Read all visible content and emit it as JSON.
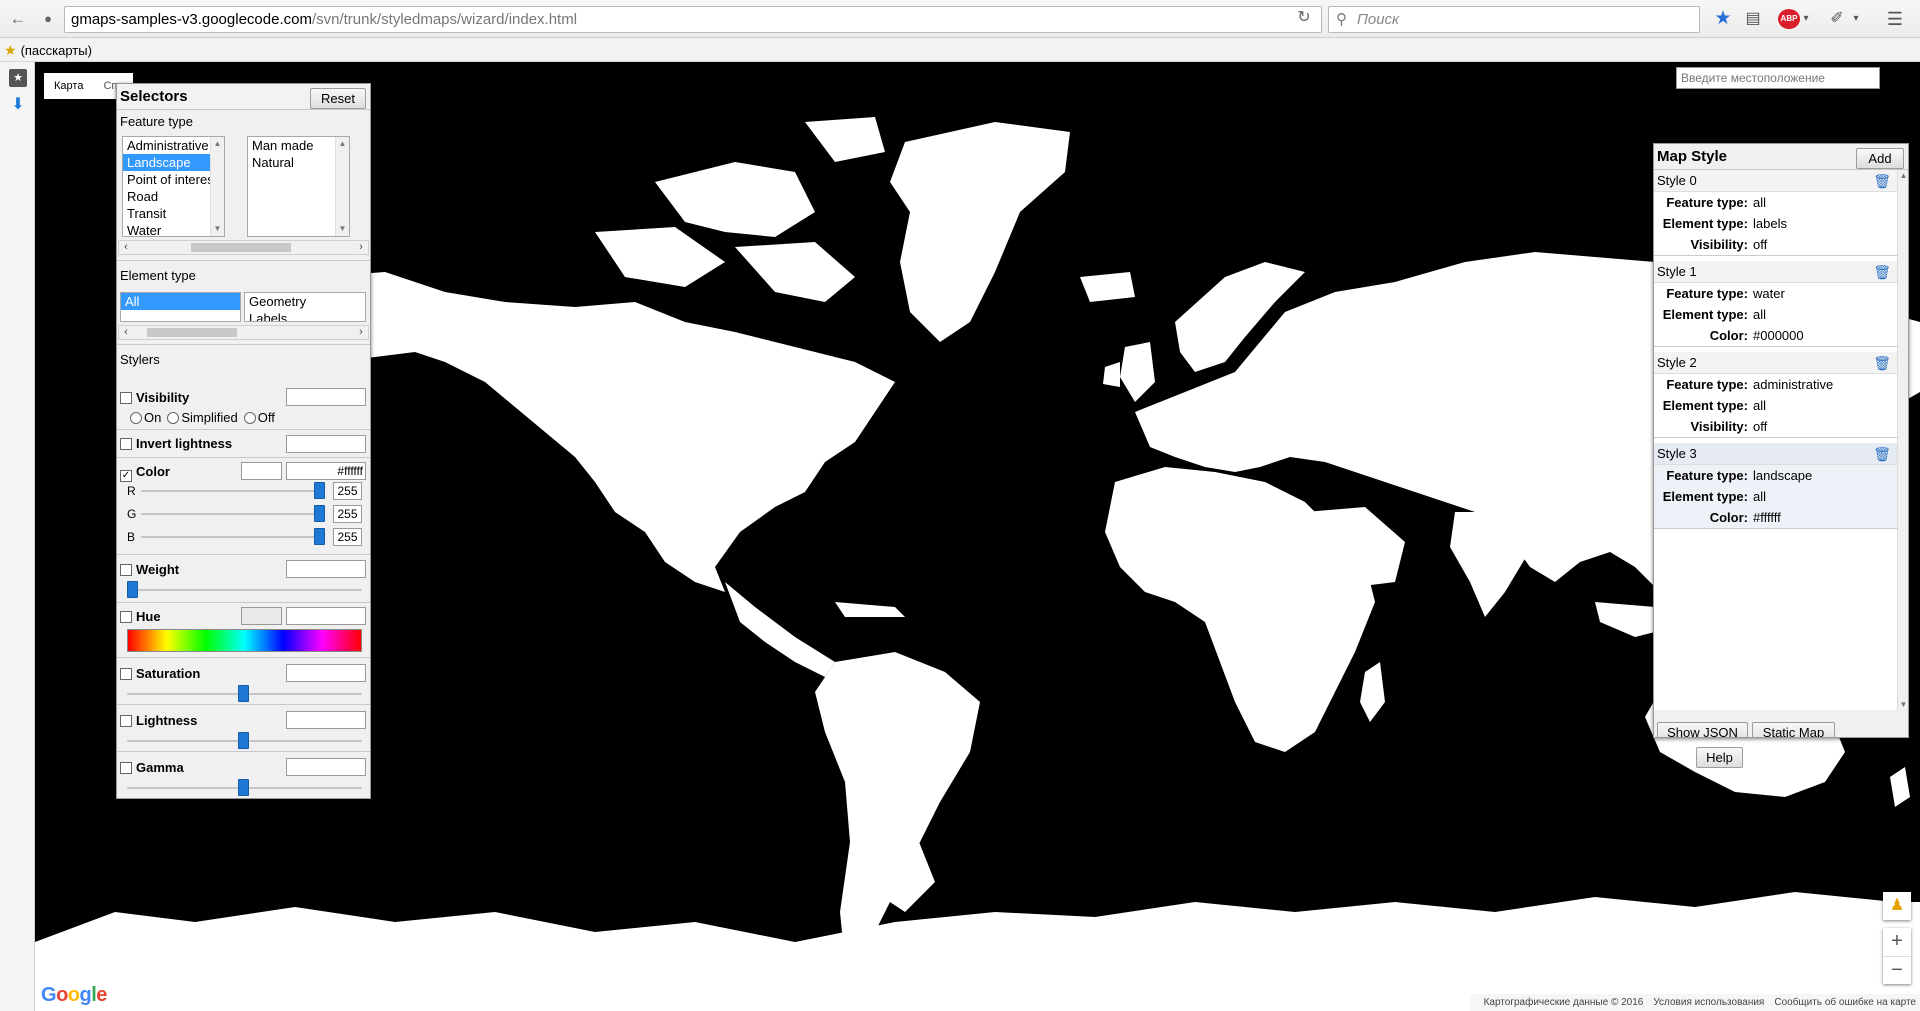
{
  "browser": {
    "url_host": "gmaps-samples-v3.googlecode.com",
    "url_path": "/svn/trunk/styledmaps/wizard/index.html",
    "search_placeholder": "Поиск",
    "bookmark_label": "(пасскарты)",
    "adblock_badge": "ABP"
  },
  "map": {
    "tab_map": "Карта",
    "tab_satellite": "Спу",
    "location_placeholder": "Введите местоположение",
    "logo": "Google",
    "attribution": "Картографические данные © 2016",
    "terms": "Условия использования",
    "report": "Сообщить об ошибке на карте",
    "land_color": "#ffffff",
    "water_color": "#000000"
  },
  "selectors": {
    "title": "Selectors",
    "reset_label": "Reset",
    "feature_type_label": "Feature type",
    "feature_types": [
      "Administrative",
      "Landscape",
      "Point of interest",
      "Road",
      "Transit",
      "Water"
    ],
    "feature_type_selected": "Landscape",
    "feature_subtypes": [
      "Man made",
      "Natural"
    ],
    "element_type_label": "Element type",
    "element_types": [
      "All"
    ],
    "element_type_selected": "All",
    "element_subtypes": [
      "Geometry",
      "Labels"
    ],
    "stylers_label": "Stylers",
    "visibility_label": "Visibility",
    "visibility_options": [
      "On",
      "Simplified",
      "Off"
    ],
    "invert_lightness_label": "Invert lightness",
    "color_label": "Color",
    "color_value": "#ffffff",
    "color_checked": true,
    "rgb": {
      "r_label": "R",
      "g_label": "G",
      "b_label": "B",
      "r": "255",
      "g": "255",
      "b": "255"
    },
    "weight_label": "Weight",
    "hue_label": "Hue",
    "saturation_label": "Saturation",
    "lightness_label": "Lightness",
    "gamma_label": "Gamma"
  },
  "map_style": {
    "title": "Map Style",
    "add_label": "Add",
    "styles": [
      {
        "name": "Style 0",
        "rows": [
          [
            "Feature type:",
            "all"
          ],
          [
            "Element type:",
            "labels"
          ],
          [
            "Visibility:",
            "off"
          ]
        ]
      },
      {
        "name": "Style 1",
        "rows": [
          [
            "Feature type:",
            "water"
          ],
          [
            "Element type:",
            "all"
          ],
          [
            "Color:",
            "#000000"
          ]
        ]
      },
      {
        "name": "Style 2",
        "rows": [
          [
            "Feature type:",
            "administrative"
          ],
          [
            "Element type:",
            "all"
          ],
          [
            "Visibility:",
            "off"
          ]
        ]
      },
      {
        "name": "Style 3",
        "rows": [
          [
            "Feature type:",
            "landscape"
          ],
          [
            "Element type:",
            "all"
          ],
          [
            "Color:",
            "#ffffff"
          ]
        ]
      }
    ],
    "show_json_label": "Show JSON",
    "static_map_label": "Static Map",
    "help_label": "Help"
  }
}
